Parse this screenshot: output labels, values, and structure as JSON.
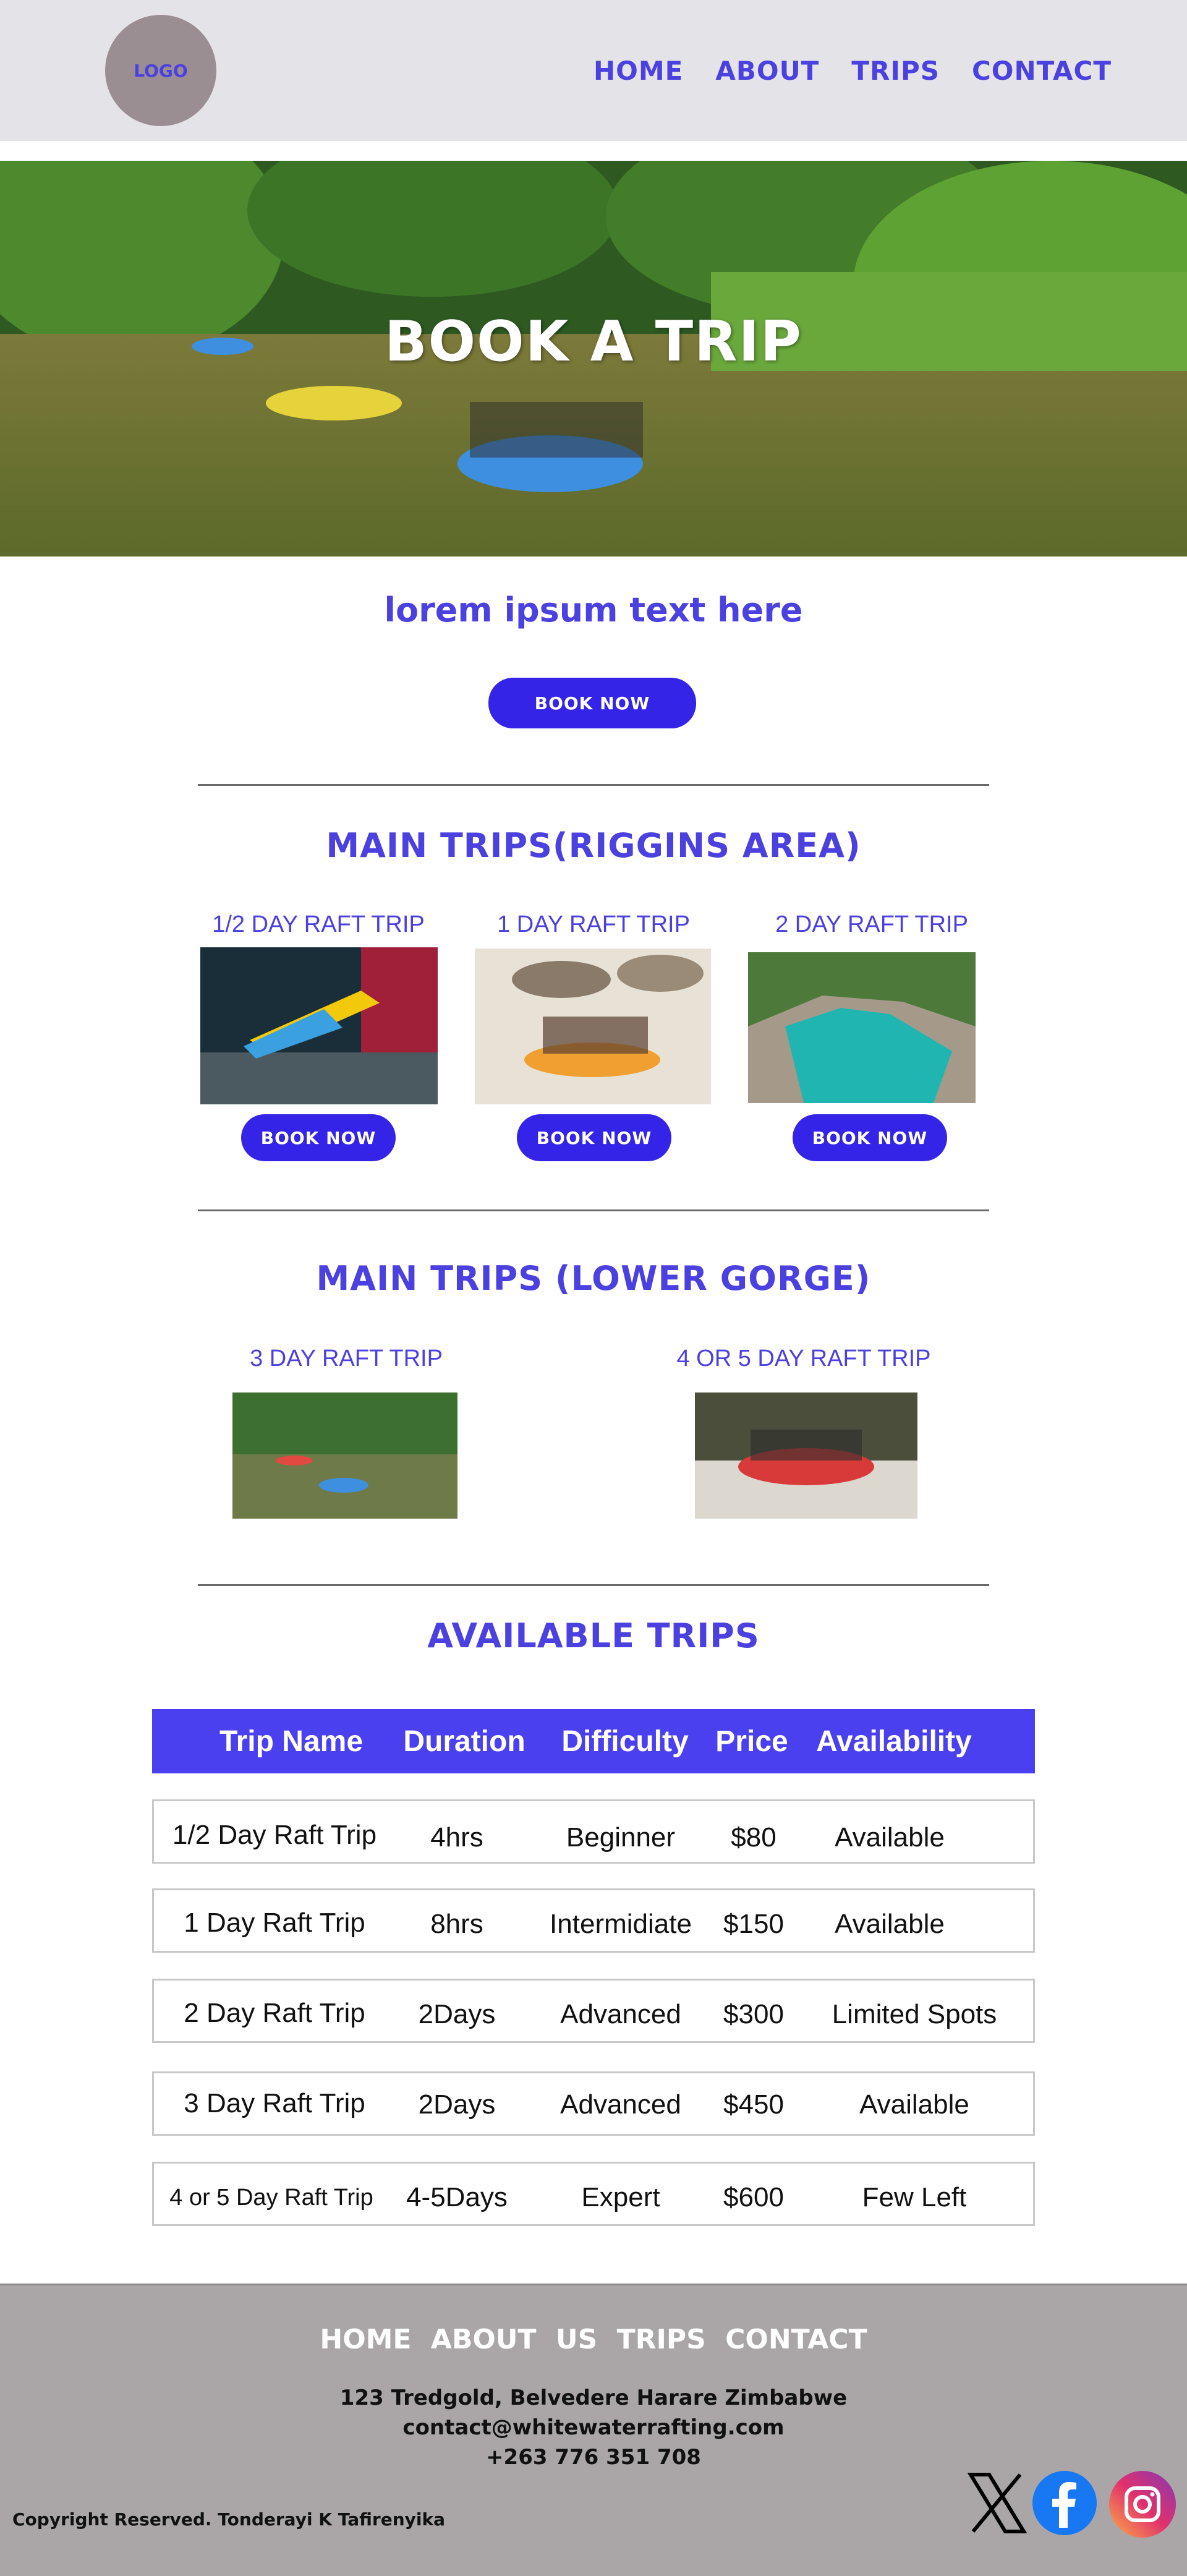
{
  "header": {
    "logo": "LOGO",
    "nav": [
      "HOME",
      "ABOUT",
      "TRIPS",
      "CONTACT"
    ]
  },
  "hero": {
    "title": "BOOK A TRIP",
    "subtitle": "lorem ipsum text here",
    "button": "BOOK NOW"
  },
  "riggins": {
    "title": "MAIN TRIPS(RIGGINS AREA)",
    "trips": [
      {
        "label": "1/2 DAY RAFT TRIP",
        "button": "BOOK NOW"
      },
      {
        "label": "1 DAY RAFT TRIP",
        "button": "BOOK NOW"
      },
      {
        "label": "2 DAY RAFT TRIP",
        "button": "BOOK NOW"
      }
    ]
  },
  "gorge": {
    "title": "MAIN TRIPS (LOWER GORGE)",
    "trips": [
      {
        "label": "3 DAY RAFT TRIP"
      },
      {
        "label": "4 OR 5 DAY RAFT TRIP"
      }
    ]
  },
  "available": {
    "title": "AVAILABLE TRIPS",
    "headers": [
      "Trip Name",
      "Duration",
      "Difficulty",
      "Price",
      "Availability"
    ],
    "rows": [
      [
        "1/2 Day Raft Trip",
        "4hrs",
        "Beginner",
        "$80",
        "Available"
      ],
      [
        "1 Day Raft Trip",
        "8hrs",
        "Intermidiate",
        "$150",
        "Available"
      ],
      [
        "2 Day Raft Trip",
        "2Days",
        "Advanced",
        "$300",
        "Limited Spots"
      ],
      [
        "3 Day Raft Trip",
        "2Days",
        "Advanced",
        "$450",
        "Available"
      ],
      [
        "4 or 5 Day Raft Trip",
        "4-5Days",
        "Expert",
        "$600",
        "Few Left"
      ]
    ]
  },
  "footer": {
    "nav": [
      "HOME",
      "ABOUT",
      "US",
      "TRIPS",
      "CONTACT"
    ],
    "address": "123 Tredgold, Belvedere Harare Zimbabwe",
    "email": "contact@whitewaterrafting.com",
    "phone": "+263 776 351 708",
    "copyright": "Copyright Reserved. Tonderayi K Tafirenyika",
    "social": [
      "x-icon",
      "facebook-icon",
      "instagram-icon"
    ]
  },
  "colors": {
    "accent": "#4b40e0",
    "button": "#3324e8",
    "header_bg": "#e4e4e8",
    "footer_bg": "#aaa6a8"
  }
}
